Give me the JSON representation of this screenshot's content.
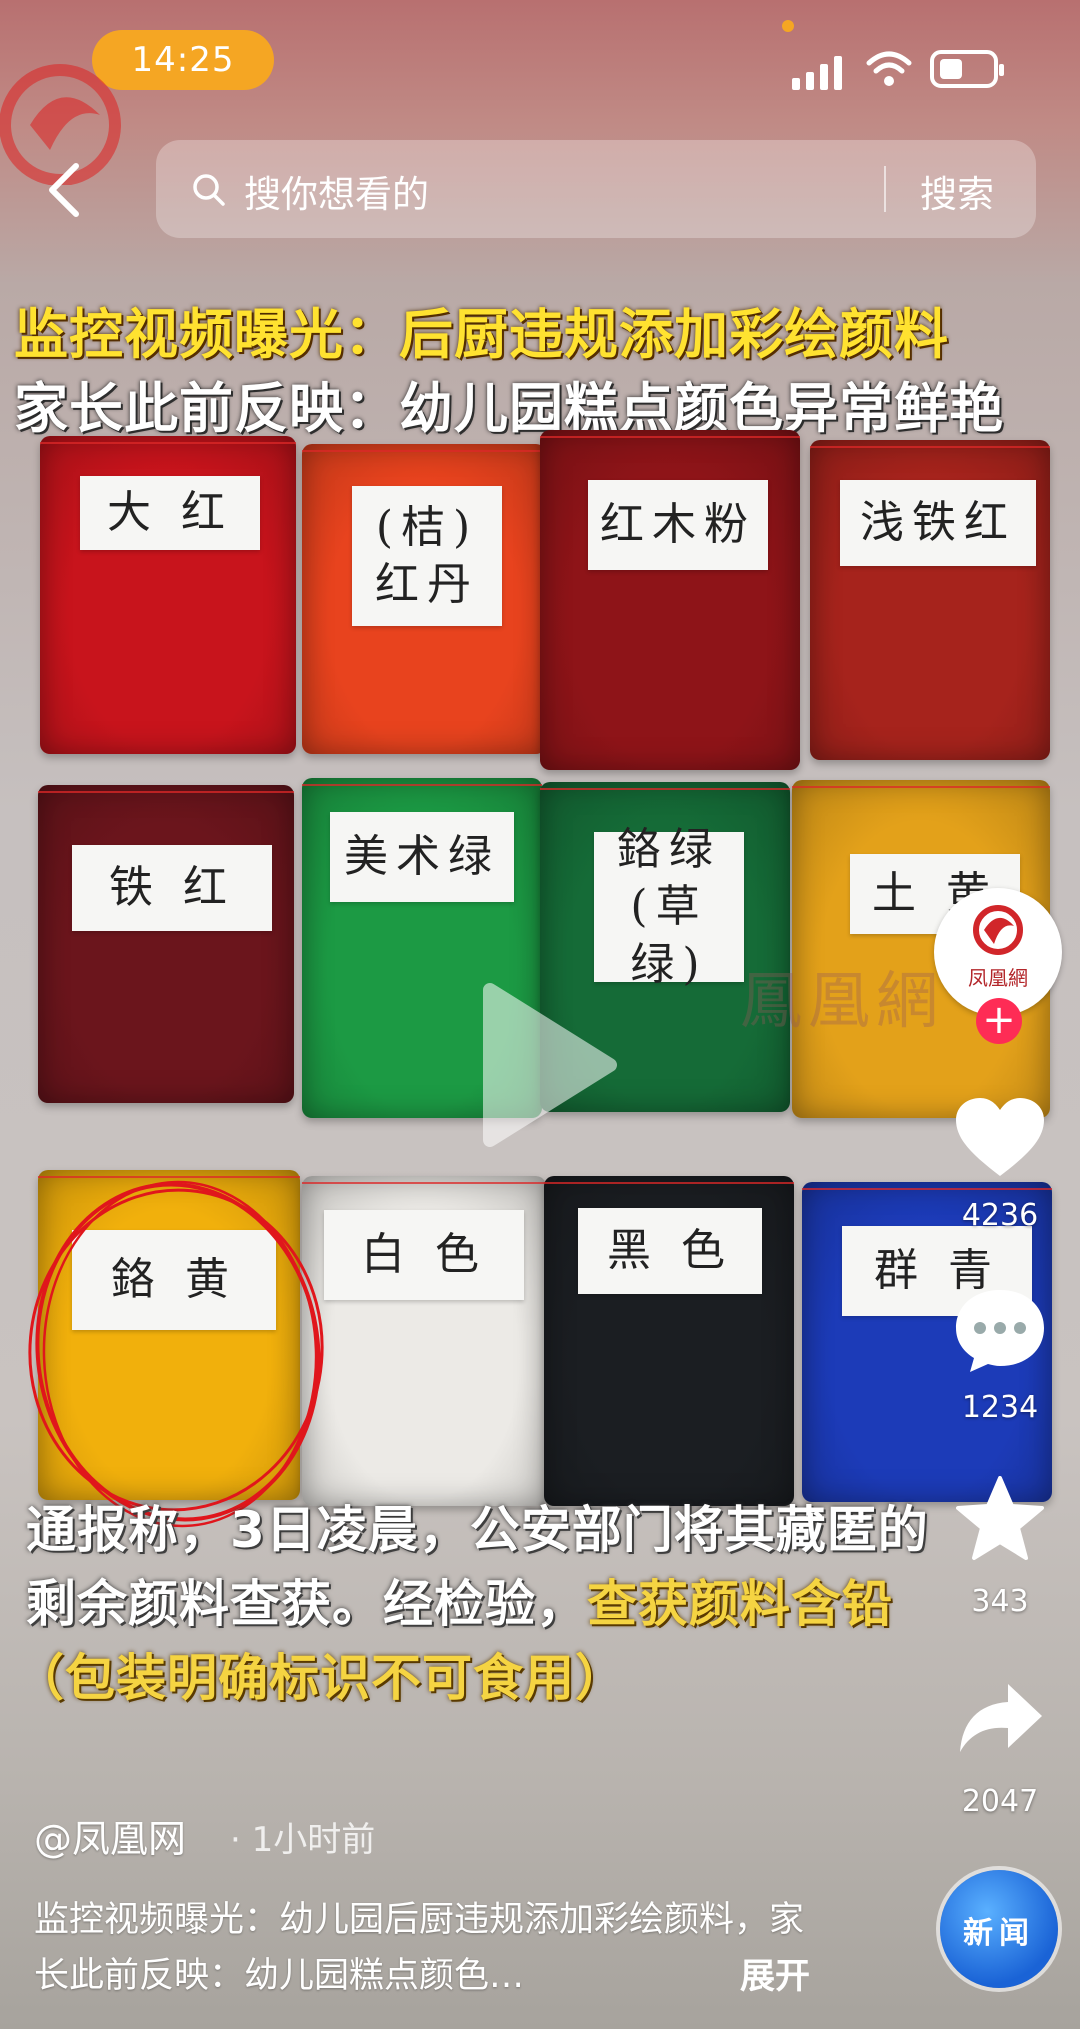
{
  "status_bar": {
    "time": "14:25"
  },
  "search": {
    "placeholder": "搜你想看的",
    "button": "搜索"
  },
  "headline": {
    "line1": "监控视频曝光：后厨违规添加彩绘颜料",
    "line2": "家长此前反映：幼儿园糕点颜色异常鲜艳"
  },
  "bags": [
    {
      "label": "大 红",
      "color": "#c8141c"
    },
    {
      "label": "(桔)\n红丹",
      "color": "#e8431e"
    },
    {
      "label": "红木粉",
      "color": "#8e1418"
    },
    {
      "label": "浅铁红",
      "color": "#a6231c"
    },
    {
      "label": "铁 红",
      "color": "#6b151c"
    },
    {
      "label": "美术绿",
      "color": "#1c9a44"
    },
    {
      "label": "鉻绿\n(草绿)",
      "color": "#156b37"
    },
    {
      "label": "土 黄",
      "color": "#e3a11a"
    },
    {
      "label": "鉻 黄",
      "color": "#f1b00c"
    },
    {
      "label": "白 色",
      "color": "#eceae6"
    },
    {
      "label": "黑 色",
      "color": "#1b1e22"
    },
    {
      "label": "群 青",
      "color": "#1c3bb8"
    }
  ],
  "watermark": "鳳凰網",
  "caption": {
    "line1": "通报称，3日凌晨，公安部门将其藏匿的",
    "line2_plain": "剩余颜料查获。经检验，",
    "line2_highlight": "查获颜料含铅",
    "line3": "（包装明确标识不可食用）"
  },
  "rail": {
    "avatar_label": "凤凰網",
    "follow": "+",
    "likes": "4236",
    "comments": "1234",
    "favorites": "343",
    "shares": "2047"
  },
  "post": {
    "author": "@凤凰网",
    "time": "· 1小时前",
    "description": "监控视频曝光：幼儿园后厨违规添加彩绘颜料，家长此前反映：幼儿园糕点颜色…",
    "expand": "展开"
  },
  "news_badge": "新闻"
}
